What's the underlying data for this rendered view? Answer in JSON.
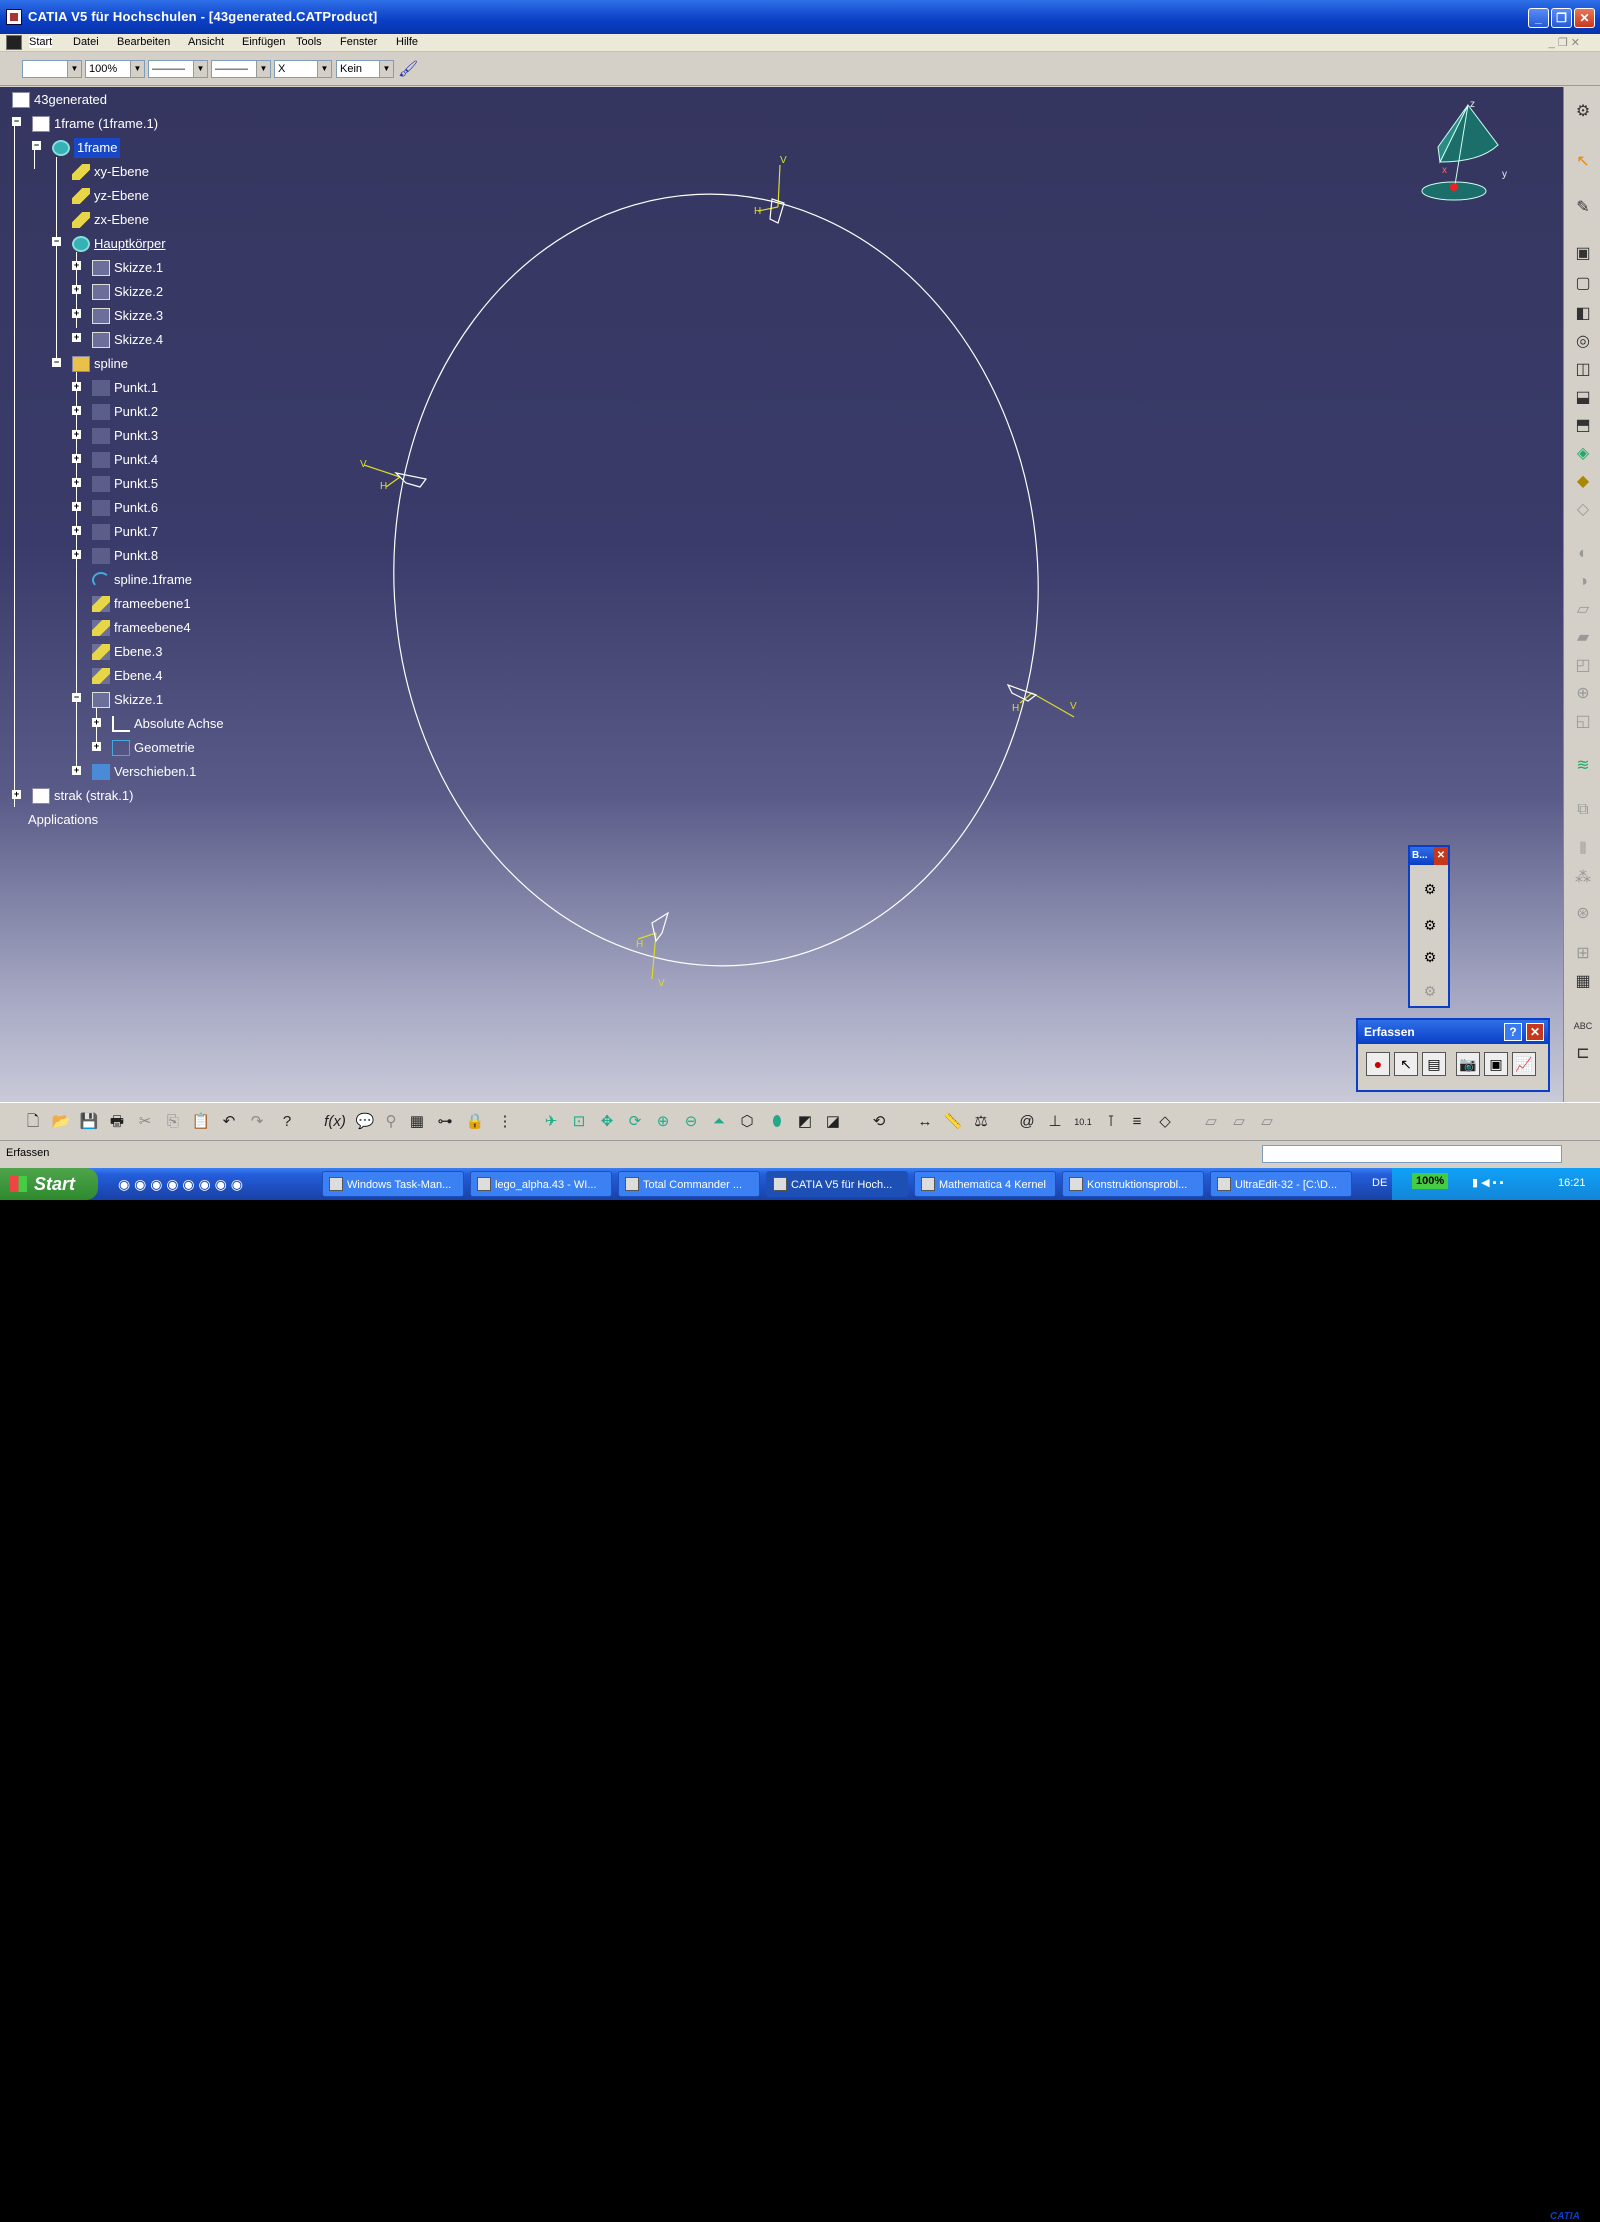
{
  "titlebar": {
    "title": "CATIA V5 für Hochschulen - [43generated.CATProduct]"
  },
  "menu": {
    "items": [
      "Start",
      "Datei",
      "Bearbeiten",
      "Ansicht",
      "Einfügen",
      "Tools",
      "Fenster",
      "Hilfe"
    ]
  },
  "toolbar": {
    "zoom_value": "100%",
    "layer_value": "Kein",
    "point_value": "X"
  },
  "tree": {
    "root": "43generated",
    "frame_instance": "1frame (1frame.1)",
    "frame_part": "1frame",
    "planes": [
      "xy-Ebene",
      "yz-Ebene",
      "zx-Ebene"
    ],
    "body": "Hauptkörper",
    "sketches": [
      "Skizze.1",
      "Skizze.2",
      "Skizze.3",
      "Skizze.4"
    ],
    "geoset": "spline",
    "points": [
      "Punkt.1",
      "Punkt.2",
      "Punkt.3",
      "Punkt.4",
      "Punkt.5",
      "Punkt.6",
      "Punkt.7",
      "Punkt.8"
    ],
    "spline_item": "spline.1frame",
    "geo_items": [
      "frameebene1",
      "frameebene4",
      "Ebene.3",
      "Ebene.4"
    ],
    "sub_sketch": "Skizze.1",
    "sub_children": [
      "Absolute Achse",
      "Geometrie"
    ],
    "translate": "Verschieben.1",
    "strak": "strak (strak.1)",
    "applications": "Applications"
  },
  "compass": {
    "axis_z": "z",
    "axis_x": "x",
    "axis_y": "y"
  },
  "axis_markers": {
    "v": "V",
    "h": "H"
  },
  "small_toolbar": {
    "title": "B..."
  },
  "capture_toolbar": {
    "title": "Erfassen"
  },
  "status_bar": {
    "text": "Erfassen"
  },
  "taskbar": {
    "start": "Start",
    "tasks": [
      "Windows Task-Man...",
      "lego_alpha.43 - WI...",
      "Total Commander ...",
      "CATIA V5 für Hoch...",
      "Mathematica 4 Kernel",
      "Konstruktionsprobl...",
      "UltraEdit-32 - [C:\\D..."
    ],
    "lang": "DE",
    "battery": "100%",
    "clock": "16:21"
  },
  "logo": {
    "text": "CATIA"
  },
  "colors": {
    "viewport_top": "#35365f",
    "viewport_bottom": "#c9cad8",
    "title_blue": "#0a3fc5",
    "tree_yellow": "#e8d64a"
  }
}
